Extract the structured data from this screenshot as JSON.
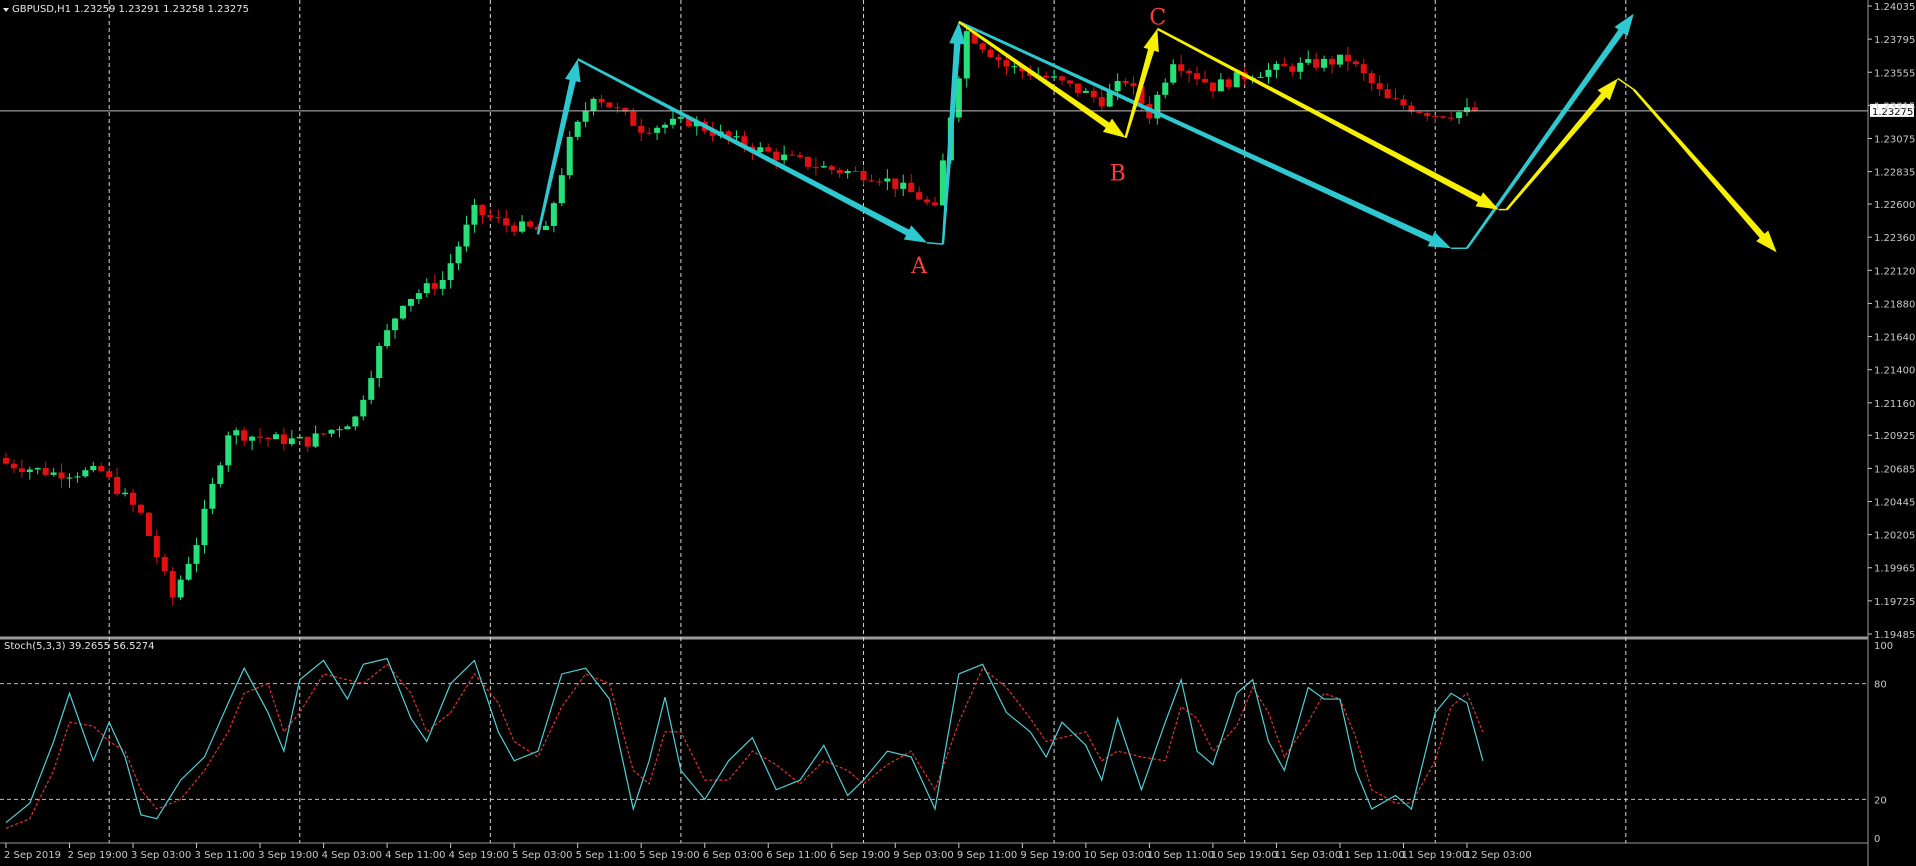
{
  "header": {
    "symbol": "GBPUSD,H1",
    "ohlc": "1.23259 1.23291 1.23258 1.23275"
  },
  "colors": {
    "background": "#000000",
    "bull": "#26e07a",
    "bear": "#e01010",
    "cyan": "#2ec9d0",
    "yellow": "#f7f000",
    "wave_label": "#ff3b3b",
    "stoch_main": "#4fd0d6",
    "stoch_signal": "#e53030"
  },
  "chart_data": [
    {
      "type": "line",
      "y_axis": {
        "range": [
          1.19485,
          1.24035
        ],
        "ticks": [
          "1.24035",
          "1.23795",
          "1.23555",
          "1.23315",
          "1.23075",
          "1.22835",
          "1.22600",
          "1.22360",
          "1.22120",
          "1.21880",
          "1.21640",
          "1.21400",
          "1.21160",
          "1.20925",
          "1.20685",
          "1.20445",
          "1.20205",
          "1.19965",
          "1.19725",
          "1.19485"
        ],
        "tick_values": [
          1.24035,
          1.23795,
          1.23555,
          1.23315,
          1.23075,
          1.22835,
          1.226,
          1.2236,
          1.2212,
          1.2188,
          1.2164,
          1.214,
          1.2116,
          1.20925,
          1.20685,
          1.20445,
          1.20205,
          1.19965,
          1.19725,
          1.19485
        ]
      },
      "price_badge": "1.23275",
      "price_line": 1.23275,
      "x_axis": {
        "labels": [
          "2 Sep 2019",
          "2 Sep 19:00",
          "3 Sep 03:00",
          "3 Sep 11:00",
          "3 Sep 19:00",
          "4 Sep 03:00",
          "4 Sep 11:00",
          "4 Sep 19:00",
          "5 Sep 03:00",
          "5 Sep 11:00",
          "5 Sep 19:00",
          "6 Sep 03:00",
          "6 Sep 11:00",
          "6 Sep 19:00",
          "9 Sep 03:00",
          "9 Sep 11:00",
          "9 Sep 19:00",
          "10 Sep 03:00",
          "10 Sep 11:00",
          "10 Sep 19:00",
          "11 Sep 03:00",
          "11 Sep 11:00",
          "11 Sep 19:00",
          "12 Sep 03:00"
        ],
        "label_bars": [
          0,
          8,
          16,
          24,
          32,
          40,
          48,
          56,
          64,
          72,
          80,
          88,
          96,
          104,
          112,
          120,
          128,
          136,
          144,
          152,
          160,
          168,
          176,
          184
        ]
      },
      "period_separator_bars": [
        13,
        37,
        61,
        85,
        108,
        132,
        156,
        180,
        204
      ],
      "bars_total": 235,
      "close_series": [
        {
          "bar": 0,
          "price": 1.2072
        },
        {
          "bar": 6,
          "price": 1.2065
        },
        {
          "bar": 12,
          "price": 1.2066
        },
        {
          "bar": 17,
          "price": 1.2035
        },
        {
          "bar": 21,
          "price": 1.1975
        },
        {
          "bar": 24,
          "price": 1.2015
        },
        {
          "bar": 28,
          "price": 1.2095
        },
        {
          "bar": 33,
          "price": 1.209
        },
        {
          "bar": 38,
          "price": 1.2088
        },
        {
          "bar": 44,
          "price": 1.2105
        },
        {
          "bar": 47,
          "price": 1.2155
        },
        {
          "bar": 50,
          "price": 1.219
        },
        {
          "bar": 55,
          "price": 1.2205
        },
        {
          "bar": 59,
          "price": 1.2255
        },
        {
          "bar": 63,
          "price": 1.2245
        },
        {
          "bar": 68,
          "price": 1.224
        },
        {
          "bar": 71,
          "price": 1.2305
        },
        {
          "bar": 74,
          "price": 1.234
        },
        {
          "bar": 80,
          "price": 1.2315
        },
        {
          "bar": 86,
          "price": 1.232
        },
        {
          "bar": 92,
          "price": 1.2305
        },
        {
          "bar": 97,
          "price": 1.2295
        },
        {
          "bar": 104,
          "price": 1.2285
        },
        {
          "bar": 110,
          "price": 1.228
        },
        {
          "bar": 115,
          "price": 1.2265
        },
        {
          "bar": 117,
          "price": 1.2255
        },
        {
          "bar": 119,
          "price": 1.2325
        },
        {
          "bar": 121,
          "price": 1.2385
        },
        {
          "bar": 126,
          "price": 1.236
        },
        {
          "bar": 132,
          "price": 1.235
        },
        {
          "bar": 138,
          "price": 1.2335
        },
        {
          "bar": 141,
          "price": 1.235
        },
        {
          "bar": 144,
          "price": 1.2325
        },
        {
          "bar": 147,
          "price": 1.2365
        },
        {
          "bar": 152,
          "price": 1.2345
        },
        {
          "bar": 157,
          "price": 1.2355
        },
        {
          "bar": 163,
          "price": 1.236
        },
        {
          "bar": 169,
          "price": 1.2365
        },
        {
          "bar": 174,
          "price": 1.2335
        },
        {
          "bar": 180,
          "price": 1.2325
        },
        {
          "bar": 185,
          "price": 1.23275
        }
      ],
      "cyan_wave": [
        {
          "bar": 67,
          "price": 1.2238
        },
        {
          "bar": 72,
          "price": 1.2365
        },
        {
          "bar": 116,
          "price": 1.2232
        },
        {
          "bar": 118,
          "price": 1.2231
        },
        {
          "bar": 120,
          "price": 1.2392
        },
        {
          "bar": 182,
          "price": 1.2228
        },
        {
          "bar": 184,
          "price": 1.2228
        },
        {
          "bar": 205,
          "price": 1.2398
        }
      ],
      "yellow_wave": [
        {
          "bar": 120,
          "price": 1.2392
        },
        {
          "bar": 141,
          "price": 1.2308
        },
        {
          "bar": 145,
          "price": 1.2387
        },
        {
          "bar": 188,
          "price": 1.2256
        },
        {
          "bar": 189,
          "price": 1.2256
        },
        {
          "bar": 203,
          "price": 1.2351
        },
        {
          "bar": 205,
          "price": 1.2343
        },
        {
          "bar": 223,
          "price": 1.2225
        }
      ],
      "wave_labels": [
        {
          "text": "A",
          "bar": 115,
          "price": 1.2216
        },
        {
          "text": "B",
          "bar": 140,
          "price": 1.2283
        },
        {
          "text": "C",
          "bar": 145,
          "price": 1.2396
        }
      ]
    },
    {
      "type": "line",
      "indicator": "Stoch(5,3,3) 39.2655 56.5274",
      "y_axis": {
        "range": [
          0,
          100
        ],
        "ticks": [
          "100",
          "80",
          "20",
          "0"
        ],
        "tick_values": [
          100,
          80,
          20,
          0
        ]
      },
      "levels": [
        80,
        20
      ],
      "series": [
        {
          "points": [
            {
              "bar": 0,
              "value": 8
            },
            {
              "bar": 3,
              "value": 18
            },
            {
              "bar": 6,
              "value": 50
            },
            {
              "bar": 8,
              "value": 75
            },
            {
              "bar": 11,
              "value": 40
            },
            {
              "bar": 13,
              "value": 60
            },
            {
              "bar": 15,
              "value": 42
            },
            {
              "bar": 17,
              "value": 12
            },
            {
              "bar": 19,
              "value": 10
            },
            {
              "bar": 22,
              "value": 30
            },
            {
              "bar": 25,
              "value": 42
            },
            {
              "bar": 28,
              "value": 70
            },
            {
              "bar": 30,
              "value": 88
            },
            {
              "bar": 33,
              "value": 65
            },
            {
              "bar": 35,
              "value": 45
            },
            {
              "bar": 37,
              "value": 82
            },
            {
              "bar": 40,
              "value": 92
            },
            {
              "bar": 43,
              "value": 72
            },
            {
              "bar": 45,
              "value": 90
            },
            {
              "bar": 48,
              "value": 93
            },
            {
              "bar": 51,
              "value": 62
            },
            {
              "bar": 53,
              "value": 50
            },
            {
              "bar": 56,
              "value": 80
            },
            {
              "bar": 59,
              "value": 92
            },
            {
              "bar": 62,
              "value": 55
            },
            {
              "bar": 64,
              "value": 40
            },
            {
              "bar": 67,
              "value": 45
            },
            {
              "bar": 70,
              "value": 85
            },
            {
              "bar": 73,
              "value": 88
            },
            {
              "bar": 76,
              "value": 72
            },
            {
              "bar": 79,
              "value": 15
            },
            {
              "bar": 81,
              "value": 40
            },
            {
              "bar": 83,
              "value": 73
            },
            {
              "bar": 85,
              "value": 35
            },
            {
              "bar": 88,
              "value": 20
            },
            {
              "bar": 91,
              "value": 40
            },
            {
              "bar": 94,
              "value": 52
            },
            {
              "bar": 97,
              "value": 25
            },
            {
              "bar": 100,
              "value": 30
            },
            {
              "bar": 103,
              "value": 48
            },
            {
              "bar": 106,
              "value": 22
            },
            {
              "bar": 108,
              "value": 30
            },
            {
              "bar": 111,
              "value": 45
            },
            {
              "bar": 114,
              "value": 42
            },
            {
              "bar": 117,
              "value": 15
            },
            {
              "bar": 120,
              "value": 85
            },
            {
              "bar": 123,
              "value": 90
            },
            {
              "bar": 126,
              "value": 65
            },
            {
              "bar": 129,
              "value": 55
            },
            {
              "bar": 131,
              "value": 42
            },
            {
              "bar": 133,
              "value": 60
            },
            {
              "bar": 136,
              "value": 48
            },
            {
              "bar": 138,
              "value": 30
            },
            {
              "bar": 140,
              "value": 62
            },
            {
              "bar": 143,
              "value": 25
            },
            {
              "bar": 146,
              "value": 60
            },
            {
              "bar": 148,
              "value": 82
            },
            {
              "bar": 150,
              "value": 45
            },
            {
              "bar": 152,
              "value": 38
            },
            {
              "bar": 155,
              "value": 75
            },
            {
              "bar": 157,
              "value": 82
            },
            {
              "bar": 159,
              "value": 50
            },
            {
              "bar": 161,
              "value": 35
            },
            {
              "bar": 164,
              "value": 78
            },
            {
              "bar": 166,
              "value": 72
            },
            {
              "bar": 168,
              "value": 72
            },
            {
              "bar": 170,
              "value": 35
            },
            {
              "bar": 172,
              "value": 15
            },
            {
              "bar": 175,
              "value": 22
            },
            {
              "bar": 177,
              "value": 15
            },
            {
              "bar": 180,
              "value": 65
            },
            {
              "bar": 182,
              "value": 75
            },
            {
              "bar": 184,
              "value": 70
            },
            {
              "bar": 186,
              "value": 40
            }
          ]
        },
        {
          "points": [
            {
              "bar": 0,
              "value": 5
            },
            {
              "bar": 3,
              "value": 10
            },
            {
              "bar": 6,
              "value": 35
            },
            {
              "bar": 8,
              "value": 60
            },
            {
              "bar": 11,
              "value": 58
            },
            {
              "bar": 13,
              "value": 50
            },
            {
              "bar": 15,
              "value": 45
            },
            {
              "bar": 17,
              "value": 25
            },
            {
              "bar": 19,
              "value": 15
            },
            {
              "bar": 22,
              "value": 20
            },
            {
              "bar": 25,
              "value": 35
            },
            {
              "bar": 28,
              "value": 55
            },
            {
              "bar": 30,
              "value": 75
            },
            {
              "bar": 33,
              "value": 80
            },
            {
              "bar": 35,
              "value": 55
            },
            {
              "bar": 37,
              "value": 65
            },
            {
              "bar": 40,
              "value": 85
            },
            {
              "bar": 43,
              "value": 82
            },
            {
              "bar": 45,
              "value": 80
            },
            {
              "bar": 48,
              "value": 90
            },
            {
              "bar": 51,
              "value": 75
            },
            {
              "bar": 53,
              "value": 55
            },
            {
              "bar": 56,
              "value": 65
            },
            {
              "bar": 59,
              "value": 85
            },
            {
              "bar": 62,
              "value": 70
            },
            {
              "bar": 64,
              "value": 50
            },
            {
              "bar": 67,
              "value": 42
            },
            {
              "bar": 70,
              "value": 68
            },
            {
              "bar": 73,
              "value": 85
            },
            {
              "bar": 76,
              "value": 80
            },
            {
              "bar": 79,
              "value": 35
            },
            {
              "bar": 81,
              "value": 28
            },
            {
              "bar": 83,
              "value": 55
            },
            {
              "bar": 85,
              "value": 55
            },
            {
              "bar": 88,
              "value": 30
            },
            {
              "bar": 91,
              "value": 30
            },
            {
              "bar": 94,
              "value": 45
            },
            {
              "bar": 97,
              "value": 38
            },
            {
              "bar": 100,
              "value": 28
            },
            {
              "bar": 103,
              "value": 40
            },
            {
              "bar": 106,
              "value": 35
            },
            {
              "bar": 108,
              "value": 28
            },
            {
              "bar": 111,
              "value": 38
            },
            {
              "bar": 114,
              "value": 45
            },
            {
              "bar": 117,
              "value": 25
            },
            {
              "bar": 120,
              "value": 60
            },
            {
              "bar": 123,
              "value": 88
            },
            {
              "bar": 126,
              "value": 78
            },
            {
              "bar": 129,
              "value": 62
            },
            {
              "bar": 131,
              "value": 50
            },
            {
              "bar": 133,
              "value": 52
            },
            {
              "bar": 136,
              "value": 55
            },
            {
              "bar": 138,
              "value": 40
            },
            {
              "bar": 140,
              "value": 45
            },
            {
              "bar": 143,
              "value": 42
            },
            {
              "bar": 146,
              "value": 40
            },
            {
              "bar": 148,
              "value": 68
            },
            {
              "bar": 150,
              "value": 62
            },
            {
              "bar": 152,
              "value": 45
            },
            {
              "bar": 155,
              "value": 58
            },
            {
              "bar": 157,
              "value": 78
            },
            {
              "bar": 159,
              "value": 65
            },
            {
              "bar": 161,
              "value": 42
            },
            {
              "bar": 164,
              "value": 60
            },
            {
              "bar": 166,
              "value": 75
            },
            {
              "bar": 168,
              "value": 72
            },
            {
              "bar": 170,
              "value": 52
            },
            {
              "bar": 172,
              "value": 25
            },
            {
              "bar": 175,
              "value": 18
            },
            {
              "bar": 177,
              "value": 18
            },
            {
              "bar": 180,
              "value": 40
            },
            {
              "bar": 182,
              "value": 68
            },
            {
              "bar": 184,
              "value": 75
            },
            {
              "bar": 186,
              "value": 55
            }
          ]
        }
      ]
    }
  ]
}
